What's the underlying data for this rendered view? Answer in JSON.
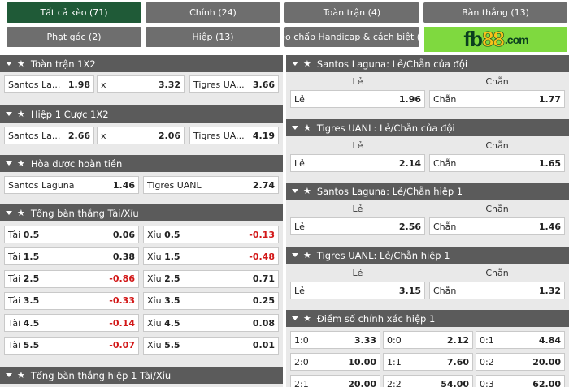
{
  "tabs": [
    {
      "label": "Tất cả kèo (71)",
      "active": true
    },
    {
      "label": "Chính (24)"
    },
    {
      "label": "Toàn trận (4)"
    },
    {
      "label": "Bàn thắng (13)"
    },
    {
      "label": "Phạt góc (2)"
    },
    {
      "label": "Hiệp (13)"
    },
    {
      "label": "Kèo chấp Handicap & cách biệt (3)"
    }
  ],
  "logo": {
    "fb": "fb",
    "num": "88",
    "dom": ".com"
  },
  "left": {
    "toan_tran_1x2": {
      "title": "Toàn trận 1X2",
      "cells": [
        {
          "label": "Santos La...",
          "value": "1.98"
        },
        {
          "label": "x",
          "value": "3.32"
        },
        {
          "label": "Tigres UA...",
          "value": "3.66"
        }
      ]
    },
    "hiep1_1x2": {
      "title": "Hiệp 1 Cược 1X2",
      "cells": [
        {
          "label": "Santos La...",
          "value": "2.66"
        },
        {
          "label": "x",
          "value": "2.06"
        },
        {
          "label": "Tigres UA...",
          "value": "4.19"
        }
      ]
    },
    "hoa_hoan_tien": {
      "title": "Hòa được hoàn tiền",
      "cells": [
        {
          "label": "Santos Laguna",
          "value": "1.46"
        },
        {
          "label": "Tigres UANL",
          "value": "2.74"
        }
      ]
    },
    "tai_xiu": {
      "title": "Tổng bàn thắng Tài/Xỉu",
      "rows": [
        {
          "tai_label": "Tài",
          "tai_line": "0.5",
          "tai_val": "0.06",
          "xiu_label": "Xỉu",
          "xiu_line": "0.5",
          "xiu_val": "-0.13"
        },
        {
          "tai_label": "Tài",
          "tai_line": "1.5",
          "tai_val": "0.38",
          "xiu_label": "Xỉu",
          "xiu_line": "1.5",
          "xiu_val": "-0.48"
        },
        {
          "tai_label": "Tài",
          "tai_line": "2.5",
          "tai_val": "-0.86",
          "xiu_label": "Xỉu",
          "xiu_line": "2.5",
          "xiu_val": "0.71"
        },
        {
          "tai_label": "Tài",
          "tai_line": "3.5",
          "tai_val": "-0.33",
          "xiu_label": "Xỉu",
          "xiu_line": "3.5",
          "xiu_val": "0.25"
        },
        {
          "tai_label": "Tài",
          "tai_line": "4.5",
          "tai_val": "-0.14",
          "xiu_label": "Xỉu",
          "xiu_line": "4.5",
          "xiu_val": "0.08"
        },
        {
          "tai_label": "Tài",
          "tai_line": "5.5",
          "tai_val": "-0.07",
          "xiu_label": "Xỉu",
          "xiu_line": "5.5",
          "xiu_val": "0.01"
        }
      ]
    },
    "tai_xiu_hiep1": {
      "title": "Tổng bàn thắng hiệp 1 Tài/Xỉu"
    }
  },
  "right": {
    "santos_lechan": {
      "title": "Santos Laguna: Lẻ/Chẵn của đội",
      "header": [
        "Lẻ",
        "Chẵn"
      ],
      "cells": [
        {
          "label": "Lẻ",
          "value": "1.96"
        },
        {
          "label": "Chẵn",
          "value": "1.77"
        }
      ]
    },
    "tigres_lechan": {
      "title": "Tigres UANL: Lẻ/Chẵn của đội",
      "header": [
        "Lẻ",
        "Chẵn"
      ],
      "cells": [
        {
          "label": "Lẻ",
          "value": "2.14"
        },
        {
          "label": "Chẵn",
          "value": "1.65"
        }
      ]
    },
    "santos_lechan_h1": {
      "title": "Santos Laguna: Lẻ/Chẵn hiệp 1",
      "header": [
        "Lẻ",
        "Chẵn"
      ],
      "cells": [
        {
          "label": "Lẻ",
          "value": "2.56"
        },
        {
          "label": "Chẵn",
          "value": "1.46"
        }
      ]
    },
    "tigres_lechan_h1": {
      "title": "Tigres UANL: Lẻ/Chẵn hiệp 1",
      "header": [
        "Lẻ",
        "Chẵn"
      ],
      "cells": [
        {
          "label": "Lẻ",
          "value": "3.15"
        },
        {
          "label": "Chẵn",
          "value": "1.32"
        }
      ]
    },
    "tyso_h1": {
      "title": "Điểm số chính xác hiệp 1",
      "rows": [
        [
          {
            "label": "1:0",
            "value": "3.33"
          },
          {
            "label": "0:0",
            "value": "2.12"
          },
          {
            "label": "0:1",
            "value": "4.84"
          }
        ],
        [
          {
            "label": "2:0",
            "value": "10.00"
          },
          {
            "label": "1:1",
            "value": "7.60"
          },
          {
            "label": "0:2",
            "value": "20.00"
          }
        ],
        [
          {
            "label": "2:1",
            "value": "20.00"
          },
          {
            "label": "2:2",
            "value": "54.00"
          },
          {
            "label": "0:3",
            "value": "62.00"
          }
        ]
      ]
    }
  },
  "colors": {
    "active_tab": "#1f5a37",
    "tab": "#6e6e6e",
    "section_header": "#5b5b5b",
    "negative": "#d21818",
    "logo_bg": "#7fd93f"
  }
}
